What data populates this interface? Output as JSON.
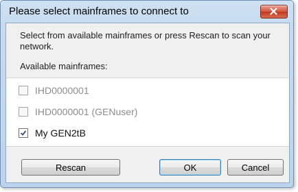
{
  "window": {
    "title": "Please select mainframes to connect to",
    "close_icon": "close-icon"
  },
  "content": {
    "description": "Select from available mainframes or press Rescan to scan your network.",
    "list_label": "Available mainframes:"
  },
  "mainframes": [
    {
      "label": "IHD0000001",
      "checked": false,
      "enabled": false
    },
    {
      "label": "IHD0000001 (GENuser)",
      "checked": false,
      "enabled": false
    },
    {
      "label": "My GEN2tB",
      "checked": true,
      "enabled": true
    }
  ],
  "buttons": {
    "rescan": "Rescan",
    "ok": "OK",
    "cancel": "Cancel"
  },
  "colors": {
    "titlebar": "#c6dbf0",
    "close_button": "#d4553d",
    "client_background": "#f0f0f0",
    "list_background": "#ffffff",
    "disabled_text": "#8c8c8c"
  }
}
